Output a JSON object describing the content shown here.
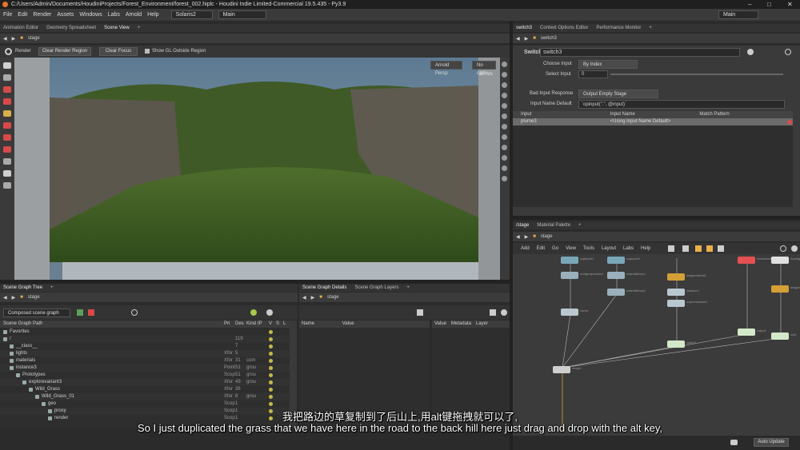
{
  "window": {
    "title": "C:/Users/Admin/Documents/HoudiniProjects/Forest_Environment/forest_002.hiplc - Houdini Indie Limited-Commercial 19.5.435 - Py3.9"
  },
  "menu": {
    "items": [
      "File",
      "Edit",
      "Render",
      "Assets",
      "Windows",
      "Labs",
      "Arnold",
      "Help"
    ],
    "desktop": "Solaris2",
    "context": "Main",
    "right_context": "Main"
  },
  "left_pane": {
    "tabs": [
      "Animation Editor",
      "Geometry Spreadsheet",
      "Scene View"
    ],
    "path": "stage",
    "render_bar": {
      "render_label": "Render",
      "clear_region": "Clear Render Region",
      "clear_focus": "Clear Focus",
      "show_gl": "Show GL Outside Region"
    },
    "camera": "Arnold Persp",
    "nocam": "No cam",
    "info": "20 hrs"
  },
  "scene_graph_tree": {
    "tab": "Scene Graph Tree",
    "path": "stage",
    "mode": "Composed scene graph",
    "columns": [
      "Scene Graph Path",
      "Pri",
      "Des",
      "Kind",
      "IP",
      "V",
      "S",
      "L"
    ],
    "rows": [
      {
        "name": "Favorites",
        "c1": "",
        "c2": "",
        "c3": "",
        "indent": 0
      },
      {
        "name": "/",
        "c1": "",
        "c2": "119",
        "c3": "",
        "indent": 0
      },
      {
        "name": "__class__",
        "c1": "",
        "c2": "7",
        "c3": "",
        "indent": 1
      },
      {
        "name": "lights",
        "c1": "Xfor",
        "c2": "5",
        "c3": "",
        "indent": 1
      },
      {
        "name": "materials",
        "c1": "Xfor",
        "c2": "31",
        "c3": "com",
        "indent": 1
      },
      {
        "name": "instance3",
        "c1": "Point",
        "c2": "51",
        "c3": "grou",
        "indent": 1
      },
      {
        "name": "Prototypes",
        "c1": "Scop",
        "c2": "51",
        "c3": "grou",
        "indent": 2
      },
      {
        "name": "explorevariant3",
        "c1": "Xfor",
        "c2": "49",
        "c3": "grou",
        "indent": 3
      },
      {
        "name": "Wild_Grass",
        "c1": "Xfor",
        "c2": "36",
        "c3": "",
        "indent": 4
      },
      {
        "name": "Wild_Grass_01",
        "c1": "Xfor",
        "c2": "8",
        "c3": "grou",
        "indent": 5
      },
      {
        "name": "geo",
        "c1": "Scop",
        "c2": "1",
        "c3": "",
        "indent": 6
      },
      {
        "name": "proxy",
        "c1": "Scop",
        "c2": "1",
        "c3": "",
        "indent": 7
      },
      {
        "name": "render",
        "c1": "Scop",
        "c2": "1",
        "c3": "",
        "indent": 7
      }
    ]
  },
  "scene_graph_details": {
    "tabs": [
      "Scene Graph Details",
      "Scene Graph Layers"
    ],
    "path": "stage",
    "columns": [
      "Name",
      "Value"
    ],
    "right_tabs": [
      "Value",
      "Metadata",
      "Layer"
    ]
  },
  "params": {
    "tabs": [
      "switch3",
      "Context Options Editor",
      "Performance Monitor"
    ],
    "node_type": "Switch",
    "node_name": "switch3",
    "choose_input_label": "Choose Input",
    "choose_input": "By Index",
    "select_input_label": "Select Input",
    "select_input": "0",
    "bad_input_label": "Bad Input Response",
    "bad_input": "Output Empty Stage",
    "input_name_default_label": "Input Name Default",
    "input_name_default": "`opinput(\".\", @input)`",
    "table_columns": [
      "Input",
      "Input Name",
      "Match Pattern"
    ],
    "table_row": {
      "input": "plume3",
      "name": "<Using Input Name Default>",
      "pattern": ""
    }
  },
  "network": {
    "tabs": [
      "/stage",
      "Material Palette"
    ],
    "path": "stage",
    "menu": [
      "Add",
      "Edit",
      "Go",
      "View",
      "Tools",
      "Layout",
      "Labs",
      "Help"
    ],
    "nodes": [
      {
        "name": "sopimport1",
        "col": "#7aa7b8"
      },
      {
        "name": "sopimport2",
        "col": "#7aa7b8"
      },
      {
        "name": "configureprimitive1",
        "col": "#9ab0bd"
      },
      {
        "name": "xform1",
        "col": "#b9c7cf"
      },
      {
        "name": "materiallibrary1",
        "col": "#9ab0bd"
      },
      {
        "name": "materiallibrary2",
        "col": "#9ab0bd"
      },
      {
        "name": "assignmaterial1",
        "col": "#d4a035"
      },
      {
        "name": "instancer1",
        "col": "#b9c7cf"
      },
      {
        "name": "explorevariants3",
        "col": "#b9c7cf"
      },
      {
        "name": "switch3",
        "col": "#d3e8c8"
      },
      {
        "name": "merge1",
        "col": "#cfcfcf"
      },
      {
        "name": "karmarendersettings1",
        "col": "#e55050"
      },
      {
        "name": "domelight1",
        "col": "#e0e0e0"
      },
      {
        "name": "assignmaterial2",
        "col": "#d4a035"
      },
      {
        "name": "output1",
        "col": "#d3e8c8"
      },
      {
        "name": "null1",
        "col": "#d3e8c8"
      }
    ]
  },
  "status": {
    "auto_update": "Auto Update"
  },
  "subtitles": {
    "cn": "我把路边的草复制到了后山上,用alt键拖拽就可以了,",
    "en": "So I just duplicated the grass that we have here in the road to the back hill here just drag and drop with the alt key,"
  }
}
